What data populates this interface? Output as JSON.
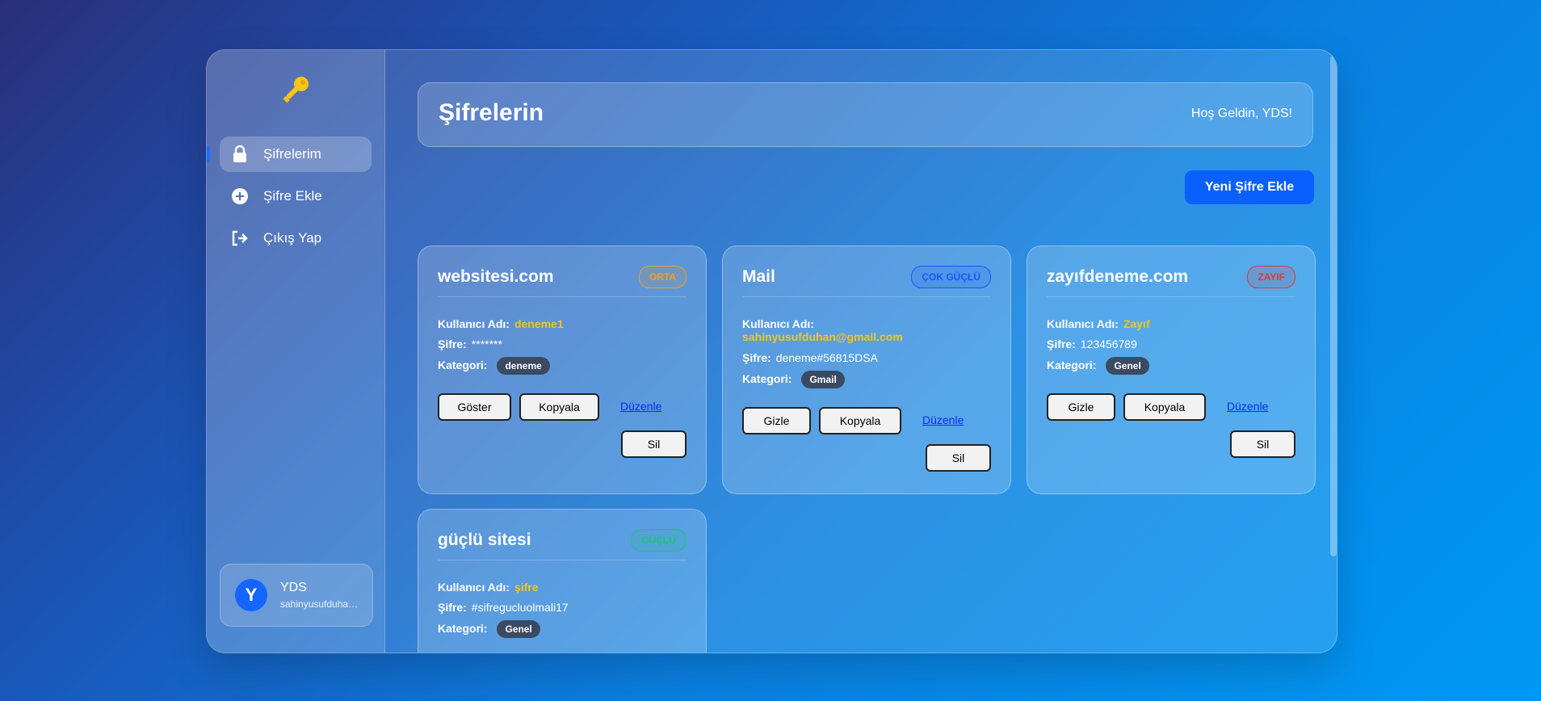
{
  "sidebar": {
    "items": [
      {
        "label": "Şifrelerim",
        "icon": "lock-icon"
      },
      {
        "label": "Şifre Ekle",
        "icon": "plus-circle-icon"
      },
      {
        "label": "Çıkış Yap",
        "icon": "logout-icon"
      }
    ],
    "user": {
      "initial": "Y",
      "name": "YDS",
      "email": "sahinyusufduhan@gmail.com"
    }
  },
  "header": {
    "title": "Şifrelerin",
    "welcome": "Hoş Geldin, YDS!"
  },
  "add_button": "Yeni Şifre Ekle",
  "labels": {
    "username": "Kullanıcı Adı:",
    "password": "Şifre:",
    "category": "Kategori:"
  },
  "cards": [
    {
      "site": "websitesi.com",
      "strength": "ORTA",
      "username": "deneme1",
      "password": "*******",
      "category": "deneme",
      "toggle": "Göster",
      "copy": "Kopyala",
      "edit": "Düzenle",
      "delete": "Sil"
    },
    {
      "site": "Mail",
      "strength": "ÇOK GÜÇLÜ",
      "username": "sahinyusufduhan@gmail.com",
      "password": "deneme#56815DSA",
      "category": "Gmail",
      "toggle": "Gizle",
      "copy": "Kopyala",
      "edit": "Düzenle",
      "delete": "Sil"
    },
    {
      "site": "zayıfdeneme.com",
      "strength": "ZAYIF",
      "username": "Zayıf",
      "password": "123456789",
      "category": "Genel",
      "toggle": "Gizle",
      "copy": "Kopyala",
      "edit": "Düzenle",
      "delete": "Sil"
    },
    {
      "site": "güçlü sitesi",
      "strength": "GÜÇLÜ",
      "username": "şifre",
      "password": "#sifregucluolmali17",
      "category": "Genel"
    }
  ],
  "colors": {
    "accent": "#0a60ff",
    "orta": "#f0a020",
    "cok_guclu": "#1a56ff",
    "zayif": "#e03a3a",
    "guclu": "#22c07a"
  }
}
